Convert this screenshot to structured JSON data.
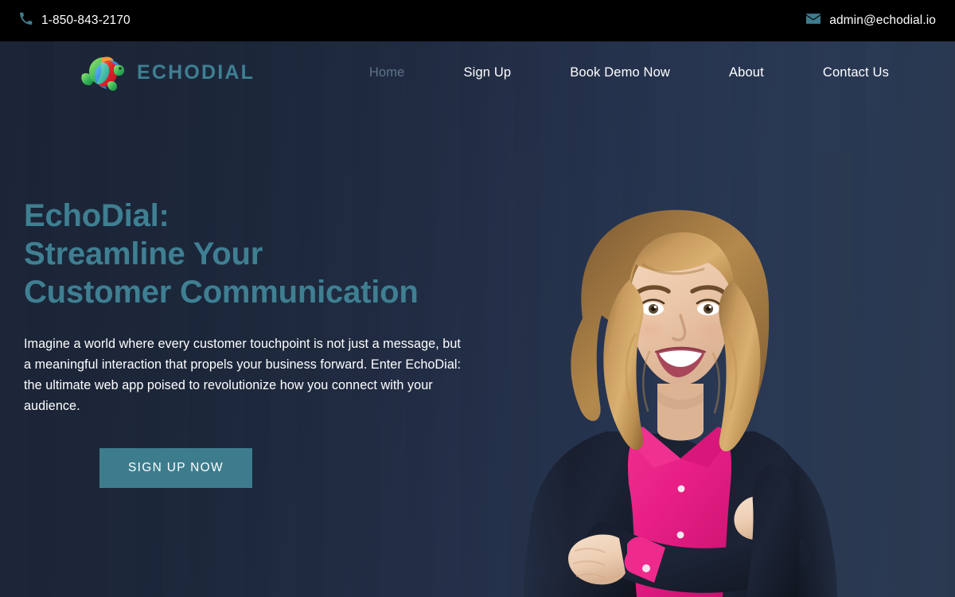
{
  "topbar": {
    "phone": "1-850-843-2170",
    "phone_icon": "phone-icon",
    "email": "admin@echodial.io",
    "email_icon": "envelope-icon",
    "background": "#000000",
    "icon_color": "#3d7c8d"
  },
  "brand": {
    "name": "ECHODIAL",
    "logo_icon": "turtle-logo-icon",
    "color": "#3f7f92"
  },
  "nav": {
    "items": [
      {
        "label": "Home",
        "active": true
      },
      {
        "label": "Sign Up",
        "active": false
      },
      {
        "label": "Book Demo Now",
        "active": false
      },
      {
        "label": "About",
        "active": false
      },
      {
        "label": "Contact Us",
        "active": false
      }
    ],
    "active_color": "#5f7489",
    "link_color": "#ffffff"
  },
  "hero": {
    "headline_lines": [
      "EchoDial:",
      "Streamline Your",
      "Customer Communication"
    ],
    "headline_color": "#3f7f92",
    "paragraph": "Imagine a world where every customer touchpoint is not just a message, but a meaningful interaction that propels your business forward. Enter EchoDial: the ultimate web app poised to revolutionize how you connect with your audience.",
    "cta_label": "SIGN UP NOW",
    "cta_color": "#3d7c8d",
    "image_alt": "smiling-businesswoman-photo",
    "background_from": "#1b2436",
    "background_to": "#2a3850"
  }
}
